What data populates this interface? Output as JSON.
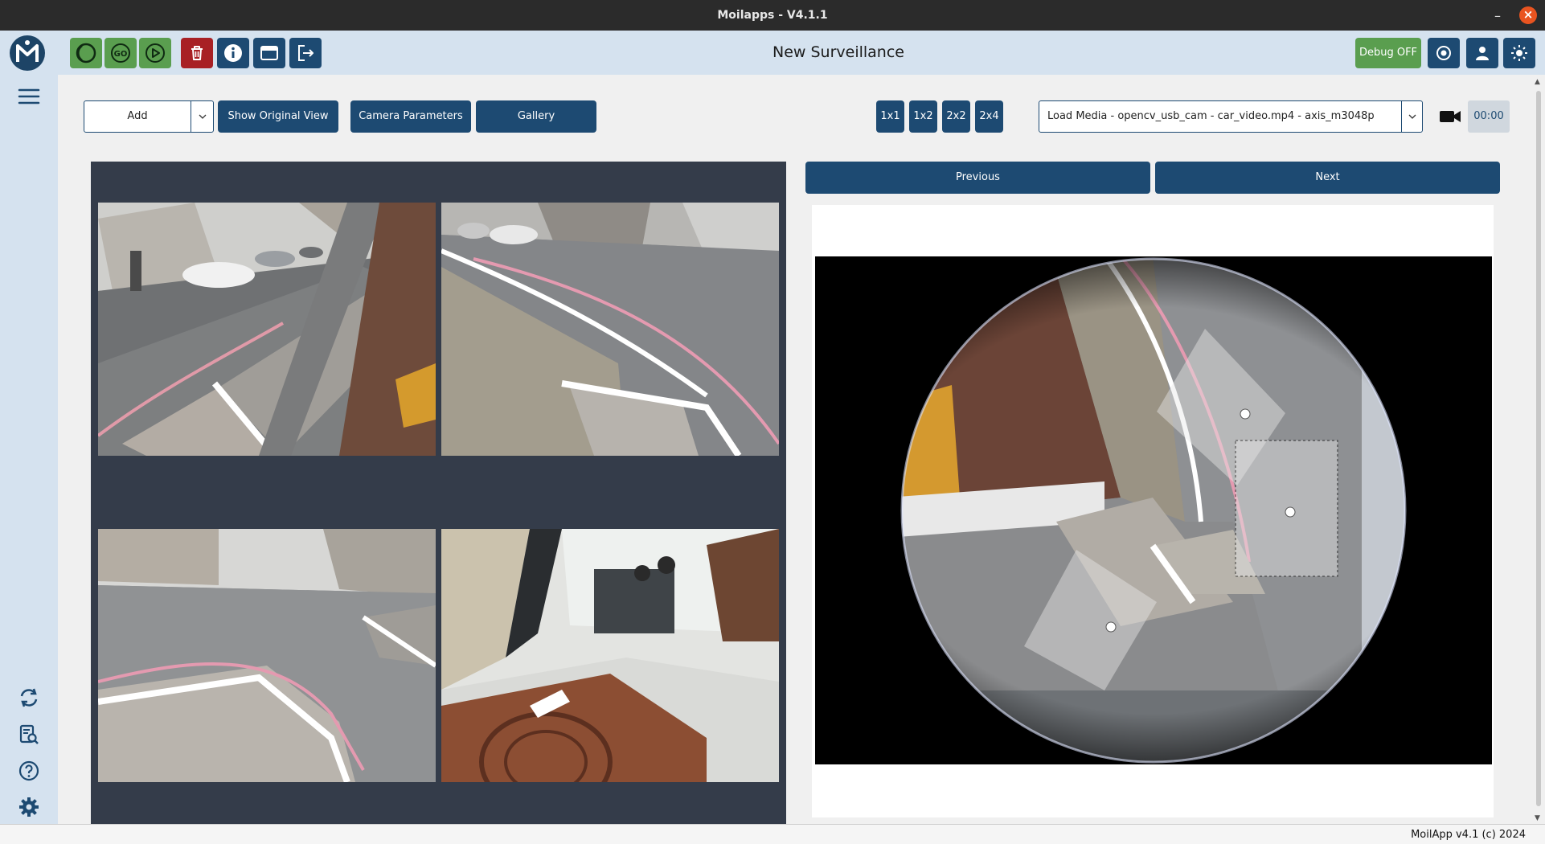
{
  "window": {
    "title": "Moilapps - V4.1.1",
    "minimize_glyph": "–",
    "close_glyph": "×"
  },
  "header": {
    "page_title": "New Surveillance",
    "debug_label": "Debug OFF",
    "toolbar_icons": [
      "moil-logo-icon",
      "lens-icon",
      "go-icon",
      "play-icon",
      "trash-icon",
      "info-icon",
      "window-icon",
      "exit-icon",
      "record-icon",
      "user-icon",
      "sun-icon"
    ],
    "go_label": "GO"
  },
  "toolbar": {
    "add_label": "Add",
    "show_original_label": "Show Original View",
    "camera_params_label": "Camera Parameters",
    "gallery_label": "Gallery",
    "grid_options": [
      "1x1",
      "1x2",
      "2x2",
      "2x4"
    ],
    "media_select_value": "Load Media - opencv_usb_cam - car_video.mp4 - axis_m3048p",
    "timer": "00:00"
  },
  "right_panel": {
    "previous_label": "Previous",
    "next_label": "Next"
  },
  "sidebar": {
    "icons": [
      "hamburger-menu-icon",
      "refresh-icon",
      "document-search-icon",
      "help-icon",
      "gear-icon"
    ]
  },
  "status": {
    "copyright": "MoilApp v4.1 (c) 2024"
  },
  "colors": {
    "navy": "#1d4a72",
    "green": "#5a9e4f",
    "red": "#a82024",
    "header_bg": "#d5e2ef",
    "panel_bg": "#343c4a"
  }
}
